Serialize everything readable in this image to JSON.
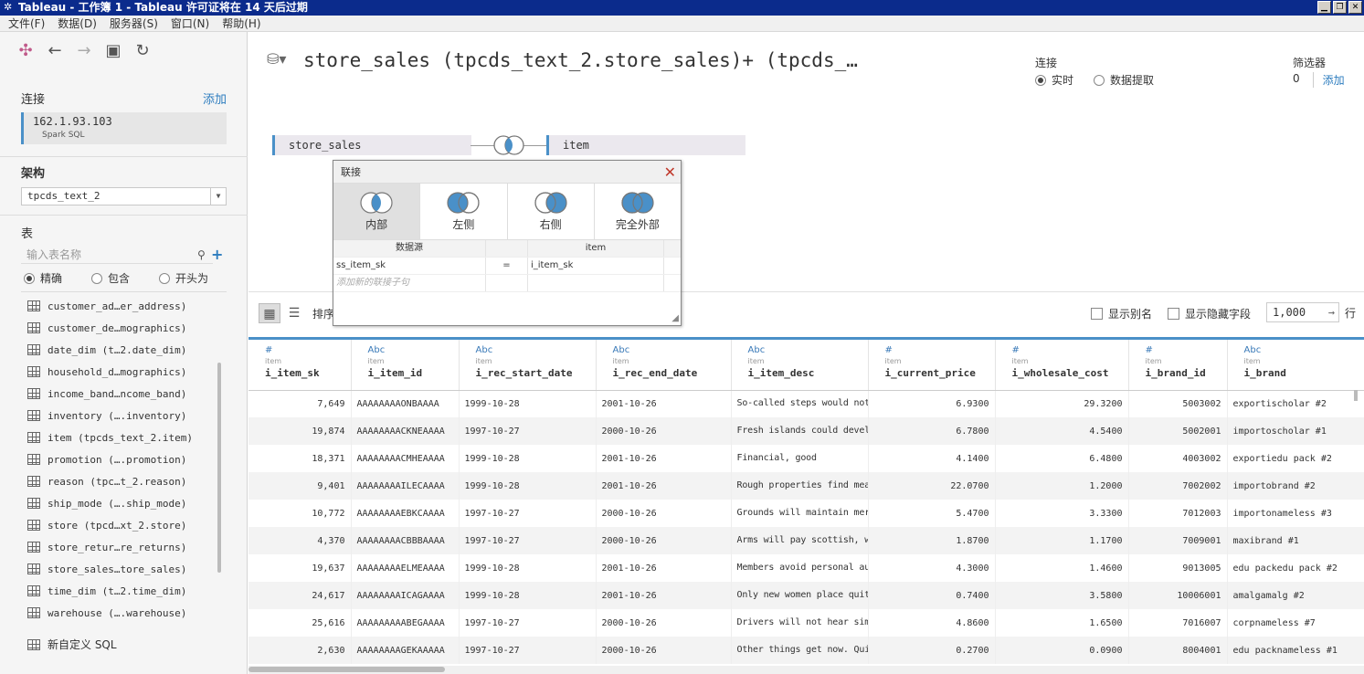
{
  "window": {
    "title": "Tableau - 工作簿 1 - Tableau 许可证将在 14 天后过期"
  },
  "menu": [
    "文件(F)",
    "数据(D)",
    "服务器(S)",
    "窗口(N)",
    "帮助(H)"
  ],
  "sidebar": {
    "connect_label": "连接",
    "connect_add": "添加",
    "connection": {
      "host": "162.1.93.103",
      "type": "Spark SQL"
    },
    "schema_label": "架构",
    "schema_value": "tpcds_text_2",
    "tables_label": "表",
    "search_placeholder": "输入表名称",
    "match_options": [
      "精确",
      "包含",
      "开头为"
    ],
    "tables": [
      "customer_ad…er_address)",
      "customer_de…mographics)",
      "date_dim (t…2.date_dim)",
      "household_d…mographics)",
      "income_band…ncome_band)",
      "inventory (….inventory)",
      "item (tpcds_text_2.item)",
      "promotion (….promotion)",
      "reason (tpc…t_2.reason)",
      "ship_mode (….ship_mode)",
      "store (tpcd…xt_2.store)",
      "store_retur…re_returns)",
      "store_sales…tore_sales)",
      "time_dim (t…2.time_dim)",
      "warehouse (….warehouse)"
    ],
    "custom_sql": "新自定义 SQL"
  },
  "main": {
    "datasource_title": "store_sales (tpcds_text_2.store_sales)+ (tpcds_…",
    "connection_label": "连接",
    "connection_options": [
      "实时",
      "数据提取"
    ],
    "filters_label": "筛选器",
    "filters_count": "0",
    "filters_add": "添加",
    "left_table": "store_sales",
    "right_table": "item"
  },
  "join_dialog": {
    "title": "联接",
    "types": [
      "内部",
      "左侧",
      "右侧",
      "完全外部"
    ],
    "selected_type": "内部",
    "col_left": "数据源",
    "col_right": "item",
    "clause": {
      "left": "ss_item_sk",
      "op": "=",
      "right": "i_item_sk"
    },
    "add_clause": "添加新的联接子句"
  },
  "grid_toolbar": {
    "sort_label": "排序",
    "show_alias": "显示别名",
    "show_hidden": "显示隐藏字段",
    "rows_value": "1,000",
    "rows_label": "行"
  },
  "grid": {
    "columns": [
      {
        "type": "#",
        "source": "item",
        "name": "i_item_sk"
      },
      {
        "type": "Abc",
        "source": "item",
        "name": "i_item_id"
      },
      {
        "type": "Abc",
        "source": "item",
        "name": "i_rec_start_date"
      },
      {
        "type": "Abc",
        "source": "item",
        "name": "i_rec_end_date"
      },
      {
        "type": "Abc",
        "source": "item",
        "name": "i_item_desc"
      },
      {
        "type": "#",
        "source": "item",
        "name": "i_current_price"
      },
      {
        "type": "#",
        "source": "item",
        "name": "i_wholesale_cost"
      },
      {
        "type": "#",
        "source": "item",
        "name": "i_brand_id"
      },
      {
        "type": "Abc",
        "source": "item",
        "name": "i_brand"
      }
    ],
    "rows": [
      [
        "7,649",
        "AAAAAAAAONBAAAA",
        "1999-10-28",
        "2001-10-26",
        "So-called steps would not see very origina…",
        "6.9300",
        "29.3200",
        "5003002",
        "exportischolar #2"
      ],
      [
        "19,874",
        "AAAAAAAACKNEAAAA",
        "1997-10-27",
        "2000-10-26",
        "Fresh islands could develop normal, gene…",
        "6.7800",
        "4.5400",
        "5002001",
        "importoscholar #1"
      ],
      [
        "18,371",
        "AAAAAAAACMHEAAAA",
        "1999-10-28",
        "2001-10-26",
        "Financial, good",
        "4.1400",
        "6.4800",
        "4003002",
        "exportiedu pack #2"
      ],
      [
        "9,401",
        "AAAAAAAAILECAAAA",
        "1999-10-28",
        "2001-10-26",
        "Rough properties find meanwhile different …",
        "22.0700",
        "1.2000",
        "7002002",
        "importobrand #2"
      ],
      [
        "10,772",
        "AAAAAAAAEBKCAAAA",
        "1997-10-27",
        "2000-10-26",
        "Grounds will maintain merely white faces; …",
        "5.4700",
        "3.3300",
        "7012003",
        "importonameless #3"
      ],
      [
        "4,370",
        "AAAAAAAACBBBAAAA",
        "1997-10-27",
        "2000-10-26",
        "Arms will pay scottish, wrong user…",
        "1.8700",
        "1.1700",
        "7009001",
        "maxibrand #1"
      ],
      [
        "19,637",
        "AAAAAAAAELMEAAAA",
        "1999-10-28",
        "2001-10-26",
        "Members avoid personal authorities. Very in…",
        "4.3000",
        "1.4600",
        "9013005",
        "edu packedu pack #2"
      ],
      [
        "24,617",
        "AAAAAAAAICAGAAAA",
        "1999-10-28",
        "2001-10-26",
        "Only new women place quite of course func…",
        "0.7400",
        "3.5800",
        "10006001",
        "amalgamalg #2"
      ],
      [
        "25,616",
        "AAAAAAAAABEGAAAA",
        "1997-10-27",
        "2000-10-26",
        "Drivers will not hear simultaneously with …",
        "4.8600",
        "1.6500",
        "7016007",
        "corpnameless #7"
      ],
      [
        "2,630",
        "AAAAAAAAGEKAAAAA",
        "1997-10-27",
        "2000-10-26",
        "Other things get now. Quite eastern system…",
        "0.2700",
        "0.0900",
        "8004001",
        "edu packnameless #1"
      ]
    ]
  },
  "colors": {
    "accent": "#4a90c8",
    "link": "#2e7dbf",
    "titlebar": "#0b2b8c"
  }
}
